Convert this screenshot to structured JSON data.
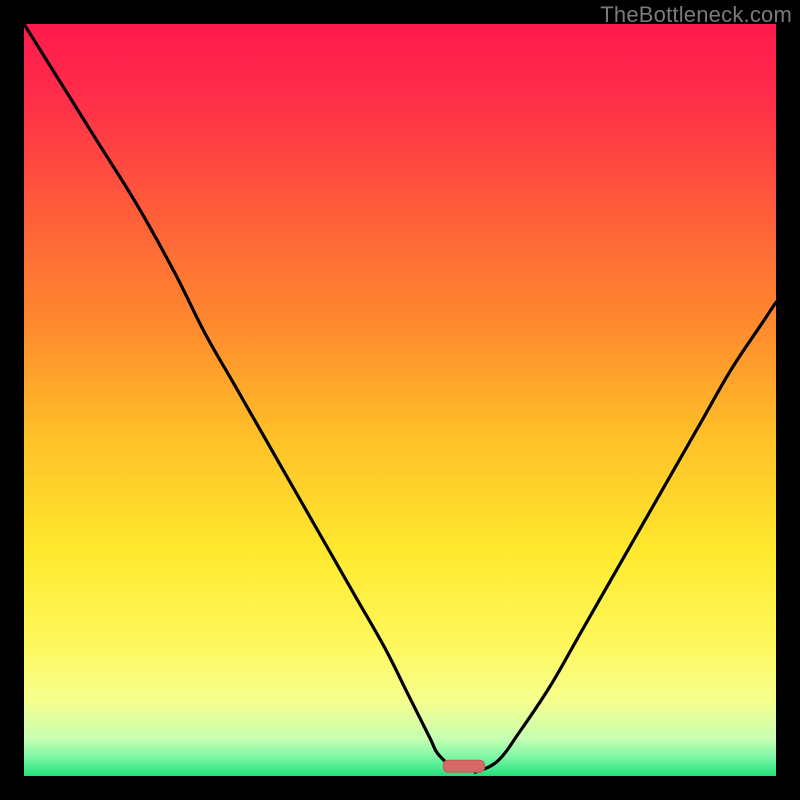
{
  "watermark": "TheBottleneck.com",
  "colors": {
    "page_bg": "#000000",
    "curve": "#000000",
    "marker_fill": "#d66868",
    "marker_stroke": "#c65858",
    "gradient_stops": [
      {
        "offset": 0.0,
        "color": "#ff1a4d"
      },
      {
        "offset": 0.1,
        "color": "#ff2e49"
      },
      {
        "offset": 0.25,
        "color": "#ff5d3a"
      },
      {
        "offset": 0.4,
        "color": "#ff8a2e"
      },
      {
        "offset": 0.55,
        "color": "#ffc028"
      },
      {
        "offset": 0.7,
        "color": "#ffe92e"
      },
      {
        "offset": 0.82,
        "color": "#fff75a"
      },
      {
        "offset": 0.9,
        "color": "#f6ff8e"
      },
      {
        "offset": 0.95,
        "color": "#c7ffb1"
      },
      {
        "offset": 0.975,
        "color": "#7cf7a5"
      },
      {
        "offset": 1.0,
        "color": "#22e07a"
      }
    ]
  },
  "chart_data": {
    "type": "line",
    "title": "",
    "xlabel": "",
    "ylabel": "",
    "xlim": [
      0,
      100
    ],
    "ylim": [
      0,
      100
    ],
    "grid": false,
    "legend": false,
    "series": [
      {
        "name": "bottleneck-curve",
        "x": [
          0,
          5,
          10,
          15,
          20,
          24,
          28,
          32,
          36,
          40,
          44,
          48,
          51,
          54,
          55,
          57,
          58,
          60,
          63,
          66,
          70,
          74,
          78,
          82,
          86,
          90,
          94,
          98,
          100
        ],
        "y": [
          100,
          92,
          84,
          76,
          67,
          59,
          52,
          45,
          38,
          31,
          24,
          17,
          11,
          5,
          3,
          1,
          0.5,
          0.5,
          2,
          6,
          12,
          19,
          26,
          33,
          40,
          47,
          54,
          60,
          63
        ]
      }
    ],
    "minimum_marker": {
      "x_center": 58.5,
      "width": 5.5,
      "y": 0.5,
      "height": 1.6
    }
  }
}
